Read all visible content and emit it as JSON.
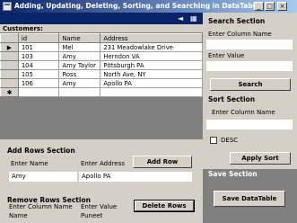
{
  "window": {
    "title": "Adding, Updating, Deleting, Sorting, and Searching in DataTable",
    "minimize": "_",
    "maximize": "□",
    "close": "×"
  },
  "grid_toolbar": {
    "back_icon": "◄",
    "forward_icon": "►",
    "table_icon": "▦"
  },
  "grid": {
    "caption": "Customers:",
    "columns": [
      "id",
      "Name",
      "Address"
    ],
    "rows": [
      {
        "marker": "▶",
        "id": "101",
        "name": "Mel",
        "address": "231 Meadowlake Drive"
      },
      {
        "marker": "",
        "id": "103",
        "name": "Amy",
        "address": "Herndon VA"
      },
      {
        "marker": "",
        "id": "104",
        "name": "Amy Taylor",
        "address": "Pittsburgh PA"
      },
      {
        "marker": "",
        "id": "105",
        "name": "Ross",
        "address": "North Ave, NY"
      },
      {
        "marker": "",
        "id": "106",
        "name": "Amy",
        "address": "Apollo PA"
      },
      {
        "marker": "✱",
        "id": "",
        "name": "",
        "address": ""
      }
    ]
  },
  "add_section": {
    "title": "Add Rows Section",
    "name_label": "Enter Name",
    "address_label": "Enter Address",
    "name_value": "Amy",
    "address_value": "Apollo PA",
    "button": "Add Row"
  },
  "remove_section": {
    "title": "Remove Rows Section",
    "column_label": "Enter Column Name",
    "value_label": "Enter Value",
    "column_value": "Name",
    "value_value": "Puneet",
    "button": "Delete Rows"
  },
  "search_section": {
    "title": "Search Section",
    "column_label": "Enter Column Name",
    "value_label": "Enter Value",
    "column_value": "",
    "value_value": "",
    "button": "Search"
  },
  "sort_section": {
    "title": "Sort Section",
    "column_label": "Enter Column Name",
    "column_value": "",
    "desc_label": "DESC",
    "desc_checked": false,
    "button": "Apply Sort"
  },
  "save_section": {
    "title": "Save Section",
    "button": "Save DataTable"
  }
}
